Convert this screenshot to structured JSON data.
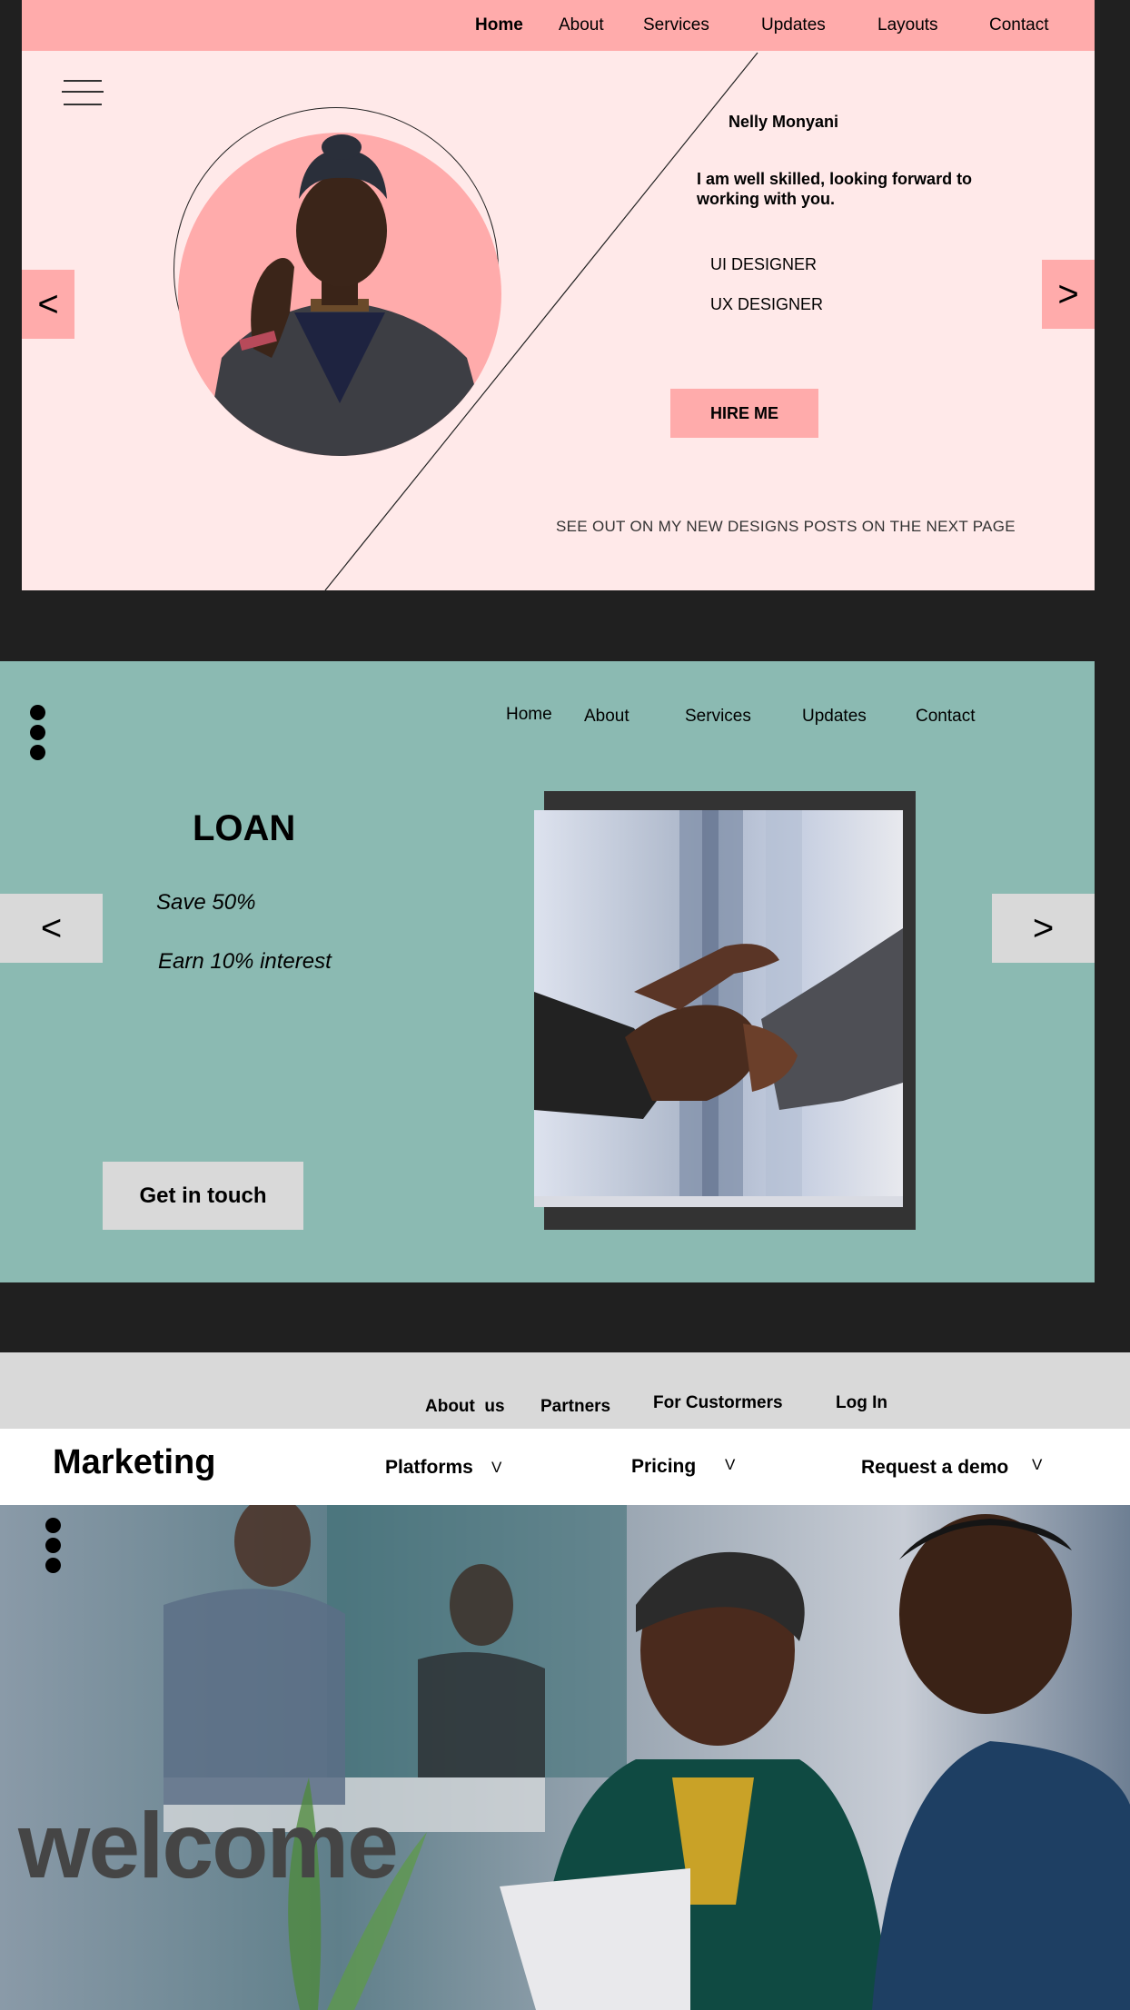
{
  "portfolio": {
    "nav": [
      "Home",
      "About",
      "Services",
      "Updates",
      "Layouts",
      "Contact"
    ],
    "prev_label": "<",
    "next_label": ">",
    "name": "Nelly Monyani",
    "tagline": "I am well skilled, looking forward to working with you.",
    "roles": [
      "UI DESIGNER",
      "UX DESIGNER"
    ],
    "hire_label": "HIRE ME",
    "footnote": "SEE OUT ON MY NEW DESIGNS POSTS ON THE NEXT PAGE",
    "colors": {
      "accent": "#ffabab",
      "background": "#ffe9e9"
    }
  },
  "loan": {
    "nav": [
      "Home",
      "About",
      "Services",
      "Updates",
      "Contact"
    ],
    "prev_label": "<",
    "next_label": ">",
    "title": "LOAN",
    "offers": [
      "Save 50%",
      "Earn 10% interest"
    ],
    "cta_label": "Get in touch",
    "colors": {
      "background": "#8bbab2",
      "button": "#d9d9d9"
    }
  },
  "marketing": {
    "utility_links": [
      "About  us",
      "Partners",
      "For Custormers",
      "Log In"
    ],
    "brand": "Marketing",
    "menus": [
      {
        "label": "Platforms",
        "chevron": "V"
      },
      {
        "label": "Pricing",
        "chevron": "V"
      },
      {
        "label": "Request a demo",
        "chevron": "V"
      }
    ],
    "hero_text": "welcome"
  }
}
